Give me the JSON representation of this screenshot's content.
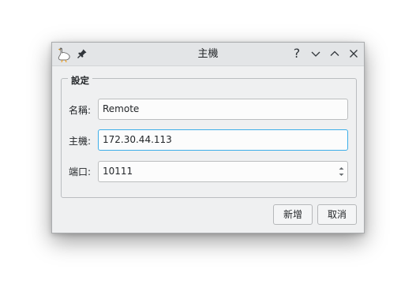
{
  "window": {
    "title": "主機",
    "help_glyph": "?"
  },
  "group": {
    "title": "設定"
  },
  "form": {
    "name_label": "名稱:",
    "name_value": "Remote",
    "host_label": "主機:",
    "host_value": "172.30.44.113",
    "port_label": "端口:",
    "port_value": "10111"
  },
  "buttons": {
    "add_label": "新增",
    "cancel_label": "取消"
  },
  "icons": {
    "app": "goose-icon",
    "pin": "pin-icon",
    "help": "help-icon",
    "minimize": "minimize-icon",
    "maximize": "maximize-icon",
    "close": "close-icon"
  },
  "colors": {
    "focus_border": "#3daee9",
    "window_bg": "#eff0f1"
  }
}
